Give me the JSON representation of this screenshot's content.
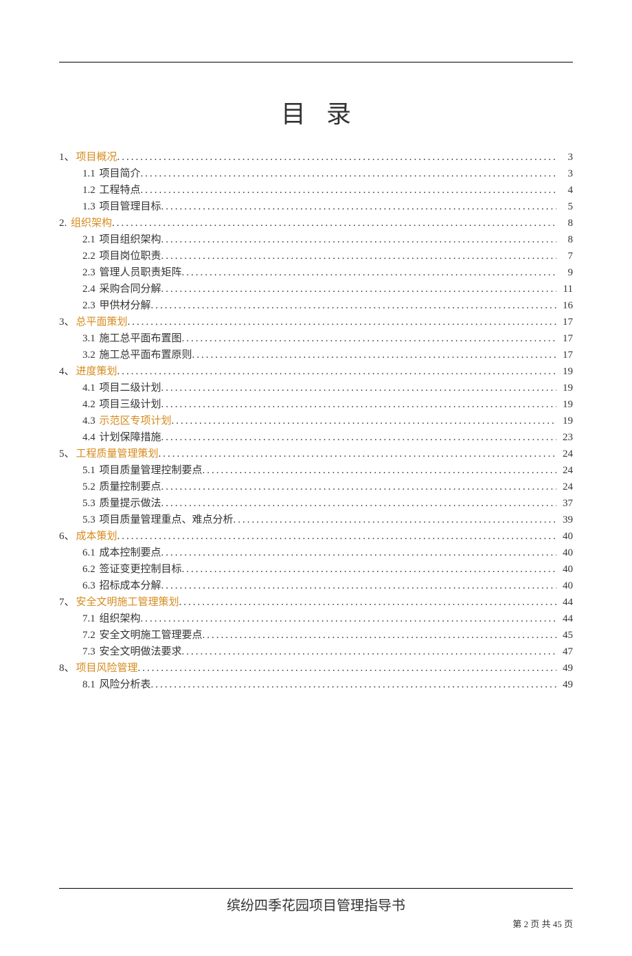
{
  "title": "目录",
  "toc": [
    {
      "level": 1,
      "num": "1、",
      "text": "项目概况",
      "link": true,
      "page": "3"
    },
    {
      "level": 2,
      "num": "1.1 ",
      "text": "项目简介",
      "link": false,
      "page": "3"
    },
    {
      "level": 2,
      "num": "1.2 ",
      "text": "工程特点",
      "link": false,
      "page": "4"
    },
    {
      "level": 2,
      "num": "1.3 ",
      "text": "项目管理目标",
      "link": false,
      "page": "5"
    },
    {
      "level": 1,
      "num": "2. ",
      "text": "组织架构",
      "link": true,
      "page": "8"
    },
    {
      "level": 2,
      "num": "2.1 ",
      "text": "项目组织架构",
      "link": false,
      "page": "8"
    },
    {
      "level": 2,
      "num": "2.2 ",
      "text": "项目岗位职责",
      "link": false,
      "page": "7"
    },
    {
      "level": 2,
      "num": "2.3 ",
      "text": "管理人员职责矩阵",
      "link": false,
      "page": "9"
    },
    {
      "level": 2,
      "num": "2.4 ",
      "text": "采购合同分解",
      "link": false,
      "page": "11"
    },
    {
      "level": 2,
      "num": "2.3 ",
      "text": "甲供材分解",
      "link": false,
      "page": "16"
    },
    {
      "level": 1,
      "num": "3、",
      "text": "总平面策划",
      "link": true,
      "page": "17"
    },
    {
      "level": 2,
      "num": "3.1 ",
      "text": "施工总平面布置图",
      "link": false,
      "page": "17"
    },
    {
      "level": 2,
      "num": "3.2 ",
      "text": "施工总平面布置原则",
      "link": false,
      "page": "17"
    },
    {
      "level": 1,
      "num": "4、",
      "text": "进度策划",
      "link": true,
      "page": "19"
    },
    {
      "level": 2,
      "num": "4.1 ",
      "text": "项目二级计划",
      "link": false,
      "page": "19"
    },
    {
      "level": 2,
      "num": "4.2 ",
      "text": "项目三级计划",
      "link": false,
      "page": "19"
    },
    {
      "level": 2,
      "num": "4.3 ",
      "text": "示范区专项计划",
      "link": true,
      "page": "19"
    },
    {
      "level": 2,
      "num": "4.4 ",
      "text": "计划保障措施",
      "link": false,
      "page": "23"
    },
    {
      "level": 1,
      "num": "5、",
      "text": "工程质量管理策划",
      "link": true,
      "page": "24"
    },
    {
      "level": 2,
      "num": "5.1 ",
      "text": "项目质量管理控制要点",
      "link": false,
      "page": "24"
    },
    {
      "level": 2,
      "num": "5.2 ",
      "text": "质量控制要点",
      "link": false,
      "page": "24"
    },
    {
      "level": 2,
      "num": "5.3 ",
      "text": "质量提示做法",
      "link": false,
      "page": "37"
    },
    {
      "level": 2,
      "num": "5.3 ",
      "text": "项目质量管理重点、难点分析",
      "link": false,
      "page": "39"
    },
    {
      "level": 1,
      "num": "6、",
      "text": "成本策划",
      "link": true,
      "page": "40"
    },
    {
      "level": 2,
      "num": "6.1 ",
      "text": "成本控制要点",
      "link": false,
      "page": "40"
    },
    {
      "level": 2,
      "num": "6.2 ",
      "text": "签证变更控制目标",
      "link": false,
      "page": "40"
    },
    {
      "level": 2,
      "num": "6.3 ",
      "text": "招标成本分解",
      "link": false,
      "page": "40"
    },
    {
      "level": 1,
      "num": "7、",
      "text": "安全文明施工管理策划",
      "link": true,
      "page": "44"
    },
    {
      "level": 2,
      "num": "7.1 ",
      "text": "组织架构",
      "link": false,
      "page": "44"
    },
    {
      "level": 2,
      "num": "7.2 ",
      "text": "安全文明施工管理要点",
      "link": false,
      "page": "45"
    },
    {
      "level": 2,
      "num": "7.3 ",
      "text": "安全文明做法要求",
      "link": false,
      "page": "47"
    },
    {
      "level": 1,
      "num": "8、",
      "text": "项目风险管理",
      "link": true,
      "page": "49"
    },
    {
      "level": 2,
      "num": "8.1 ",
      "text": "风险分析表",
      "link": false,
      "page": "49"
    }
  ],
  "footer": {
    "doc_title": "缤纷四季花园项目管理指导书",
    "page_label_prefix": "第 ",
    "page_current": "2",
    "page_label_mid": " 页 共 ",
    "page_total": "45",
    "page_label_suffix": " 页"
  }
}
